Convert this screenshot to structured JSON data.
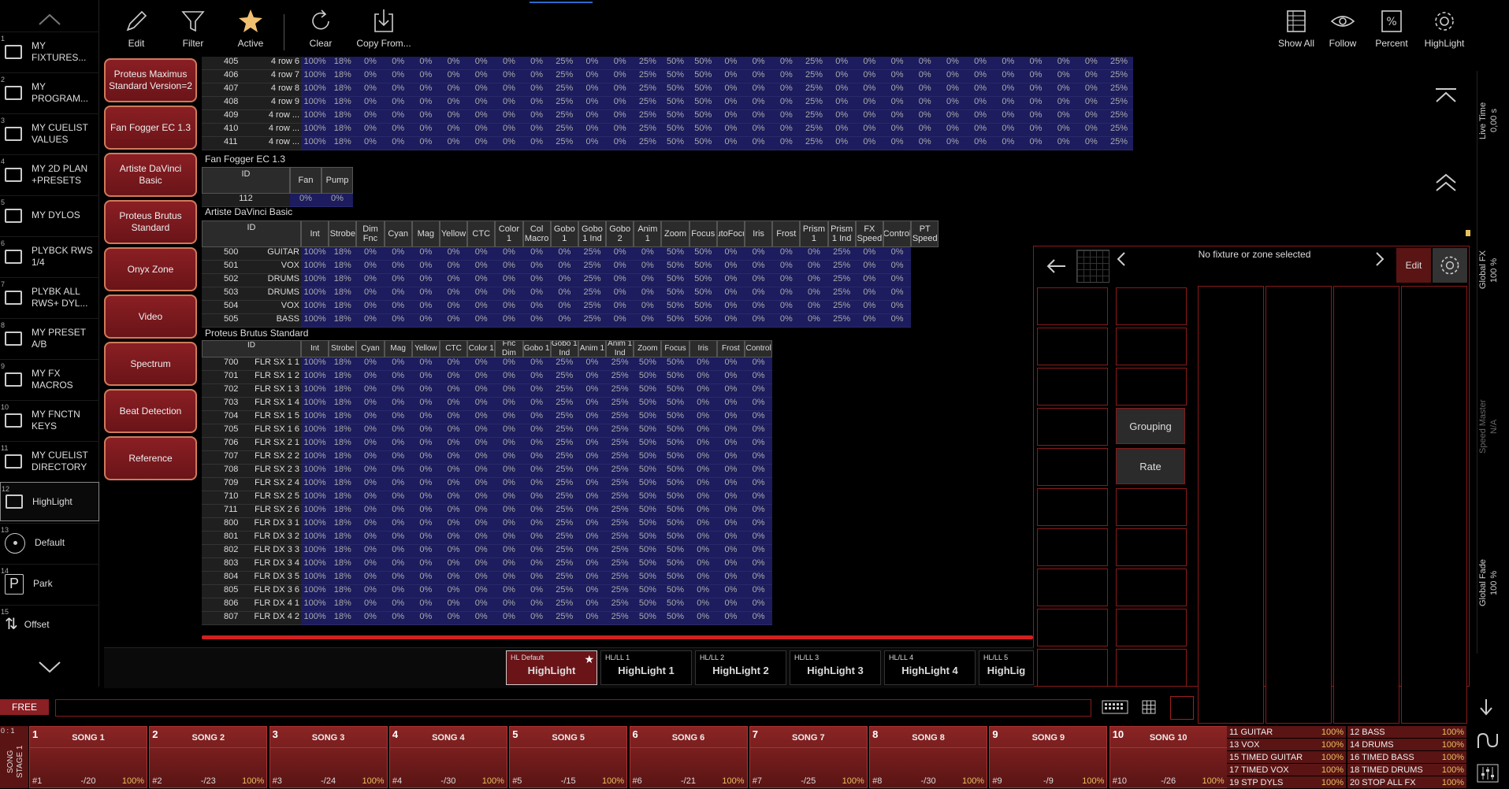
{
  "sidebar": {
    "items": [
      {
        "num": "1",
        "label": "MY FIXTURES...",
        "icon": "box"
      },
      {
        "num": "2",
        "label": "MY PROGRAM...",
        "icon": "box"
      },
      {
        "num": "3",
        "label": "MY CUELIST VALUES",
        "icon": "box"
      },
      {
        "num": "4",
        "label": "MY 2D PLAN +PRESETS",
        "icon": "box"
      },
      {
        "num": "5",
        "label": "MY DYLOS",
        "icon": "box"
      },
      {
        "num": "6",
        "label": "PLYBCK RWS 1/4",
        "icon": "box"
      },
      {
        "num": "7",
        "label": "PLYBK ALL RWS+ DYL...",
        "icon": "box"
      },
      {
        "num": "8",
        "label": "MY PRESET A/B",
        "icon": "box"
      },
      {
        "num": "9",
        "label": "MY FX MACROS",
        "icon": "box"
      },
      {
        "num": "10",
        "label": "MY FNCTN KEYS",
        "icon": "box"
      },
      {
        "num": "11",
        "label": "MY CUELIST DIRECTORY",
        "icon": "box"
      },
      {
        "num": "12",
        "label": "HighLight",
        "icon": "box"
      },
      {
        "num": "13",
        "label": "Default",
        "icon": "circle"
      },
      {
        "num": "14",
        "label": "Park",
        "icon": "p"
      },
      {
        "num": "15",
        "label": "Offset",
        "icon": "offset"
      }
    ]
  },
  "fixture_types": [
    "Proteus Maximus Standard Version=2",
    "Fan Fogger EC 1.3",
    "Artiste DaVinci Basic",
    "Proteus Brutus Standard",
    "Onyx Zone",
    "Video",
    "Spectrum",
    "Beat Detection",
    "Reference"
  ],
  "toolbar": {
    "left": [
      "Edit",
      "Filter",
      "Active",
      "Clear",
      "Copy From..."
    ],
    "right": [
      "Show All",
      "Follow",
      "Percent",
      "HighLight"
    ]
  },
  "table1": {
    "vals": [
      "100%",
      "18%",
      "0%",
      "0%",
      "0%",
      "0%",
      "0%",
      "0%",
      "0%",
      "25%",
      "0%",
      "0%",
      "25%",
      "50%",
      "50%",
      "0%",
      "0%",
      "0%",
      "25%",
      "0%",
      "0%",
      "0%",
      "0%",
      "0%",
      "0%",
      "0%",
      "0%",
      "0%",
      "0%",
      "25%"
    ],
    "rows": [
      [
        "405",
        "4 row 6"
      ],
      [
        "406",
        "4 row 7"
      ],
      [
        "407",
        "4 row 8"
      ],
      [
        "408",
        "4 row 9"
      ],
      [
        "409",
        "4 row ..."
      ],
      [
        "410",
        "4 row ..."
      ],
      [
        "411",
        "4 row ..."
      ]
    ]
  },
  "table2": {
    "title": "Fan Fogger EC 1.3",
    "headers": [
      "ID",
      "Fan",
      "Pump"
    ],
    "rows": [
      [
        "112",
        "0%",
        "0%"
      ]
    ]
  },
  "table3": {
    "title": "Artiste DaVinci Basic",
    "headers": [
      "ID",
      "Int",
      "Strobe",
      "Dim Fnc",
      "Cyan",
      "Mag",
      "Yellow",
      "CTC",
      "Color 1",
      "Col Macro",
      "Gobo 1",
      "Gobo 1 Ind",
      "Gobo 2",
      "Anim 1",
      "Zoom",
      "Focus",
      "AutoFocus",
      "Iris",
      "Frost",
      "Prism 1",
      "Prism 1 Ind",
      "FX Speed",
      "Control",
      "PT Speed"
    ],
    "vals": [
      "100%",
      "18%",
      "0%",
      "0%",
      "0%",
      "0%",
      "0%",
      "0%",
      "0%",
      "0%",
      "25%",
      "0%",
      "0%",
      "50%",
      "50%",
      "0%",
      "0%",
      "0%",
      "0%",
      "25%",
      "0%",
      "0%"
    ],
    "rows": [
      [
        "500",
        "GUITAR"
      ],
      [
        "501",
        "VOX"
      ],
      [
        "502",
        "DRUMS"
      ],
      [
        "503",
        "DRUMS"
      ],
      [
        "504",
        "VOX"
      ],
      [
        "505",
        "BASS"
      ]
    ]
  },
  "table4": {
    "title": "Proteus Brutus Standard",
    "headers": [
      "ID",
      "Int",
      "Strobe",
      "Cyan",
      "Mag",
      "Yellow",
      "CTC",
      "Color 1",
      "Dim Fnc Dim Dela...",
      "Gobo 1",
      "Gobo 1 Ind",
      "Anim 1",
      "Anim 1 Ind",
      "Zoom",
      "Focus",
      "Iris",
      "Frost",
      "Control"
    ],
    "vals": [
      "100%",
      "18%",
      "0%",
      "0%",
      "0%",
      "0%",
      "0%",
      "0%",
      "0%",
      "25%",
      "0%",
      "25%",
      "50%",
      "50%",
      "0%",
      "0%",
      "0%"
    ],
    "rows": [
      [
        "700",
        "FLR SX 1 1"
      ],
      [
        "701",
        "FLR SX 1 2"
      ],
      [
        "702",
        "FLR SX 1 3"
      ],
      [
        "703",
        "FLR SX 1 4"
      ],
      [
        "704",
        "FLR SX 1 5"
      ],
      [
        "705",
        "FLR SX 1 6"
      ],
      [
        "706",
        "FLR SX 2 1"
      ],
      [
        "707",
        "FLR SX 2 2"
      ],
      [
        "708",
        "FLR SX 2 3"
      ],
      [
        "709",
        "FLR SX 2 4"
      ],
      [
        "710",
        "FLR SX 2 5"
      ],
      [
        "711",
        "FLR SX 2 6"
      ],
      [
        "800",
        "FLR DX 3 1"
      ],
      [
        "801",
        "FLR DX 3 2"
      ],
      [
        "802",
        "FLR DX 3 3"
      ],
      [
        "803",
        "FLR DX 3 4"
      ],
      [
        "804",
        "FLR DX 3 5"
      ],
      [
        "805",
        "FLR DX 3 6"
      ],
      [
        "806",
        "FLR DX 4 1"
      ],
      [
        "807",
        "FLR DX 4 2"
      ]
    ]
  },
  "overlay": {
    "title": "No fixture or zone selected",
    "edit": "Edit",
    "grouping": "Grouping",
    "rate": "Rate"
  },
  "highlight_cards": [
    {
      "small": "HL Default",
      "label": "HighLight"
    },
    {
      "small": "HL/LL 1",
      "label": "HighLight 1"
    },
    {
      "small": "HL/LL 2",
      "label": "HighLight 2"
    },
    {
      "small": "HL/LL 3",
      "label": "HighLight 3"
    },
    {
      "small": "HL/LL 4",
      "label": "HighLight 4"
    },
    {
      "small": "HL/LL 5",
      "label": "HighLig"
    }
  ],
  "command": {
    "free": "FREE"
  },
  "songs": [
    {
      "n": "1",
      "t": "SONG 1",
      "b": "#1",
      "m": "-/20",
      "p": "100%"
    },
    {
      "n": "2",
      "t": "SONG 2",
      "b": "#2",
      "m": "-/23",
      "p": "100%"
    },
    {
      "n": "3",
      "t": "SONG 3",
      "b": "#3",
      "m": "-/24",
      "p": "100%"
    },
    {
      "n": "4",
      "t": "SONG 4",
      "b": "#4",
      "m": "-/30",
      "p": "100%"
    },
    {
      "n": "5",
      "t": "SONG 5",
      "b": "#5",
      "m": "-/15",
      "p": "100%"
    },
    {
      "n": "6",
      "t": "SONG 6",
      "b": "#6",
      "m": "-/21",
      "p": "100%"
    },
    {
      "n": "7",
      "t": "SONG 7",
      "b": "#7",
      "m": "-/25",
      "p": "100%"
    },
    {
      "n": "8",
      "t": "SONG 8",
      "b": "#8",
      "m": "-/30",
      "p": "100%"
    },
    {
      "n": "9",
      "t": "SONG 9",
      "b": "#9",
      "m": "-/9",
      "p": "100%"
    },
    {
      "n": "10",
      "t": "SONG 10",
      "b": "#10",
      "m": "-/26",
      "p": "100%"
    }
  ],
  "song_stage": "SONG STAGE 1",
  "song_stage_num": "0 : 1",
  "mini_cues": [
    [
      "11 GUITAR",
      "100%"
    ],
    [
      "12 BASS",
      "100%"
    ],
    [
      "13 VOX",
      "100%"
    ],
    [
      "14 DRUMS",
      "100%"
    ],
    [
      "15 TIMED GUITAR",
      "100%"
    ],
    [
      "16 TIMED BASS",
      "100%"
    ],
    [
      "17 TIMED VOX",
      "100%"
    ],
    [
      "18 TIMED DRUMS",
      "100%"
    ],
    [
      "19 STP DYLS",
      "100%"
    ],
    [
      "20 STOP ALL FX",
      "100%"
    ]
  ],
  "right_labels": {
    "live_time": "Live Time",
    "live_time_val": "0,00 s",
    "global_fx": "Global FX",
    "global_fx_val": "100 %",
    "speed_master": "Speed Master",
    "speed_master_val": "N/A",
    "global_fade": "Global Fade",
    "global_fade_val": "100 %"
  },
  "colors": {
    "accent": "#8a1f24",
    "grid": "#1c1c5e",
    "border_red": "#8a1a1a"
  }
}
